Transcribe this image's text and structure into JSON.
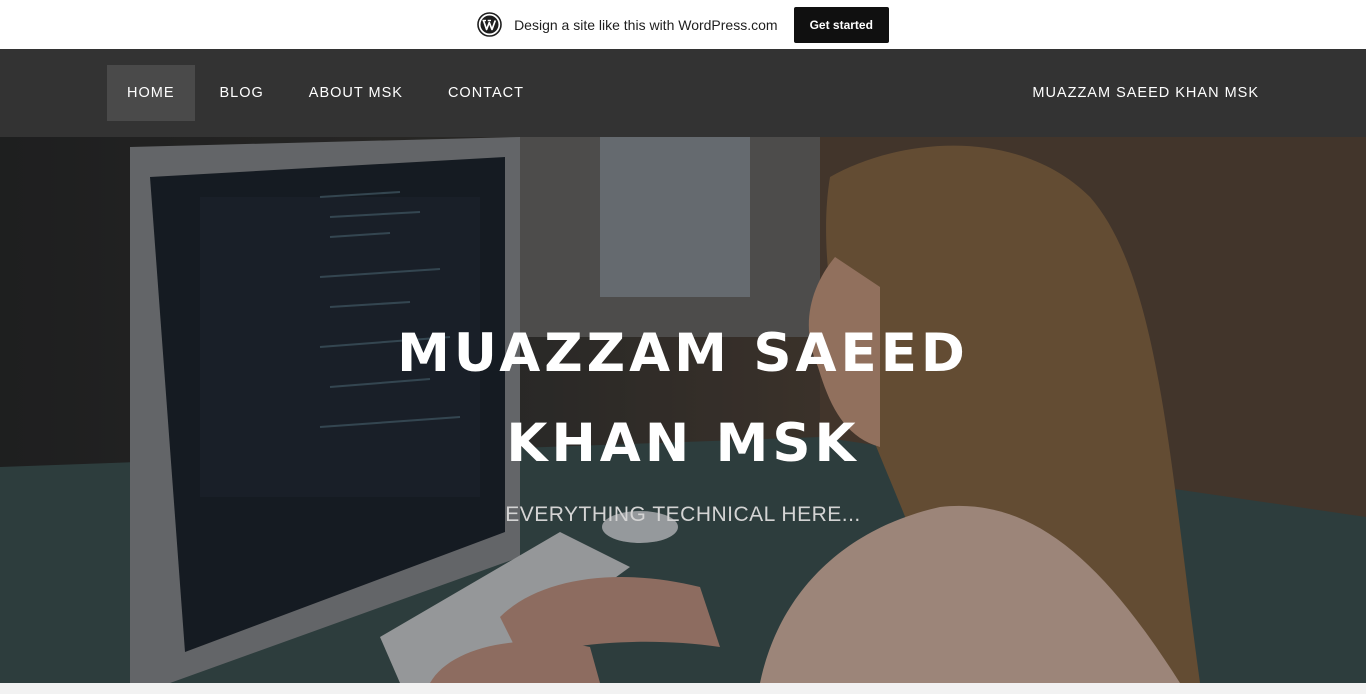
{
  "banner": {
    "text": "Design a site like this with WordPress.com",
    "cta_label": "Get started",
    "logo_icon": "wordpress-logo-icon"
  },
  "nav": {
    "items": [
      {
        "label": "HOME",
        "active": true
      },
      {
        "label": "BLOG",
        "active": false
      },
      {
        "label": "ABOUT MSK",
        "active": false
      },
      {
        "label": "CONTACT",
        "active": false
      }
    ],
    "site_name": "MUAZZAM SAEED KHAN MSK"
  },
  "hero": {
    "title": "MUAZZAM SAEED KHAN MSK",
    "tagline": "EVERYTHING TECHNICAL HERE..."
  },
  "colors": {
    "nav_bg": "#333333",
    "nav_active_bg": "#4a4a4a",
    "banner_button_bg": "#101010"
  }
}
